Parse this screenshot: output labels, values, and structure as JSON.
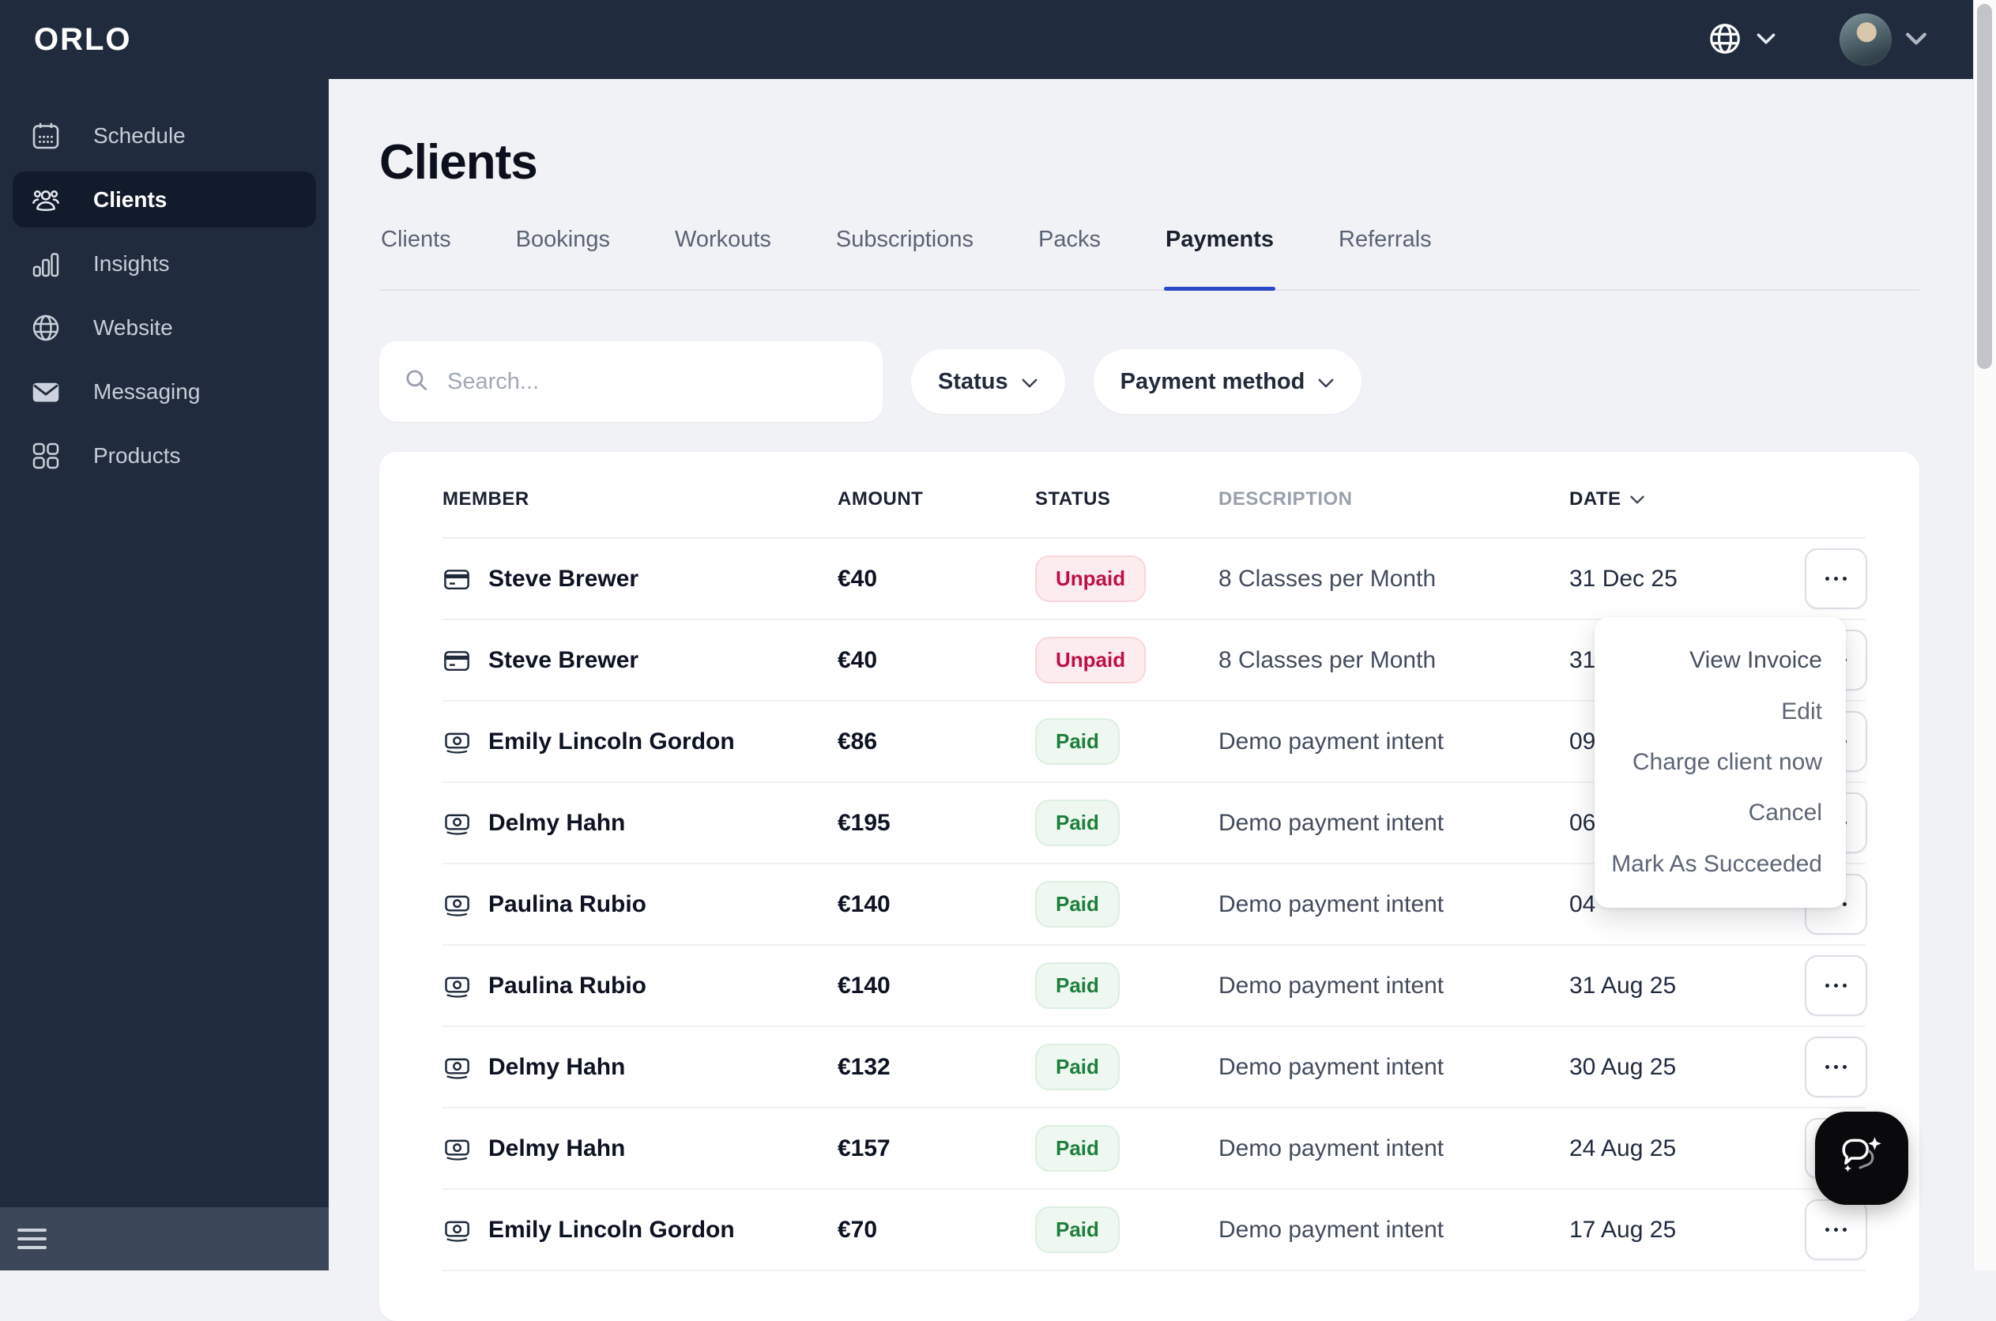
{
  "brand": {
    "logo": "ORLO"
  },
  "topbar": {
    "language_icon": "globe-icon",
    "account_icon": "avatar",
    "chevron_icon": "chevron-down-icon"
  },
  "sidebar": {
    "items": [
      {
        "label": "Schedule",
        "icon": "calendar-icon",
        "active": false
      },
      {
        "label": "Clients",
        "icon": "people-icon",
        "active": true
      },
      {
        "label": "Insights",
        "icon": "bar-chart-icon",
        "active": false
      },
      {
        "label": "Website",
        "icon": "globe-icon",
        "active": false
      },
      {
        "label": "Messaging",
        "icon": "envelope-icon",
        "active": false
      },
      {
        "label": "Products",
        "icon": "grid-icon",
        "active": false
      }
    ]
  },
  "page": {
    "title": "Clients"
  },
  "tabs": [
    {
      "label": "Clients",
      "active": false
    },
    {
      "label": "Bookings",
      "active": false
    },
    {
      "label": "Workouts",
      "active": false
    },
    {
      "label": "Subscriptions",
      "active": false
    },
    {
      "label": "Packs",
      "active": false
    },
    {
      "label": "Payments",
      "active": true
    },
    {
      "label": "Referrals",
      "active": false
    }
  ],
  "filters": {
    "search_placeholder": "Search...",
    "status_label": "Status",
    "payment_method_label": "Payment method"
  },
  "table": {
    "columns": [
      {
        "label": "MEMBER"
      },
      {
        "label": "AMOUNT"
      },
      {
        "label": "STATUS"
      },
      {
        "label": "DESCRIPTION",
        "muted": true
      },
      {
        "label": "DATE",
        "sortable": true
      },
      {
        "label": ""
      }
    ],
    "rows": [
      {
        "icon": "credit-card-icon",
        "member": "Steve Brewer",
        "amount": "€40",
        "status": "Unpaid",
        "status_type": "unpaid",
        "description": "8 Classes per Month",
        "date": "31 Dec 25"
      },
      {
        "icon": "credit-card-icon",
        "member": "Steve Brewer",
        "amount": "€40",
        "status": "Unpaid",
        "status_type": "unpaid",
        "description": "8 Classes per Month",
        "date": "31"
      },
      {
        "icon": "cash-icon",
        "member": "Emily Lincoln Gordon",
        "amount": "€86",
        "status": "Paid",
        "status_type": "paid",
        "description": "Demo payment intent",
        "date": "09"
      },
      {
        "icon": "cash-icon",
        "member": "Delmy Hahn",
        "amount": "€195",
        "status": "Paid",
        "status_type": "paid",
        "description": "Demo payment intent",
        "date": "06"
      },
      {
        "icon": "cash-icon",
        "member": "Paulina Rubio",
        "amount": "€140",
        "status": "Paid",
        "status_type": "paid",
        "description": "Demo payment intent",
        "date": "04"
      },
      {
        "icon": "cash-icon",
        "member": "Paulina Rubio",
        "amount": "€140",
        "status": "Paid",
        "status_type": "paid",
        "description": "Demo payment intent",
        "date": "31 Aug 25"
      },
      {
        "icon": "cash-icon",
        "member": "Delmy Hahn",
        "amount": "€132",
        "status": "Paid",
        "status_type": "paid",
        "description": "Demo payment intent",
        "date": "30 Aug 25"
      },
      {
        "icon": "cash-icon",
        "member": "Delmy Hahn",
        "amount": "€157",
        "status": "Paid",
        "status_type": "paid",
        "description": "Demo payment intent",
        "date": "24 Aug 25"
      },
      {
        "icon": "cash-icon",
        "member": "Emily Lincoln Gordon",
        "amount": "€70",
        "status": "Paid",
        "status_type": "paid",
        "description": "Demo payment intent",
        "date": "17 Aug 25"
      }
    ]
  },
  "context_menu": {
    "items": [
      "View Invoice",
      "Edit",
      "Charge client now",
      "Cancel",
      "Mark As Succeeded"
    ]
  },
  "fab": {
    "icon": "chat-sparkle-icon"
  },
  "colors": {
    "sidebar_bg": "#202c3d",
    "sidebar_active_bg": "#121b2c",
    "sidebar_footer_bg": "#3b4658",
    "accent_underline": "#2b49c7",
    "unpaid_text": "#bf0f45",
    "unpaid_bg": "#fdecee",
    "paid_text": "#1e7e3d",
    "paid_bg": "#eef8f0",
    "content_bg": "#f1f2f5",
    "fab_bg": "#0a0a0c"
  }
}
